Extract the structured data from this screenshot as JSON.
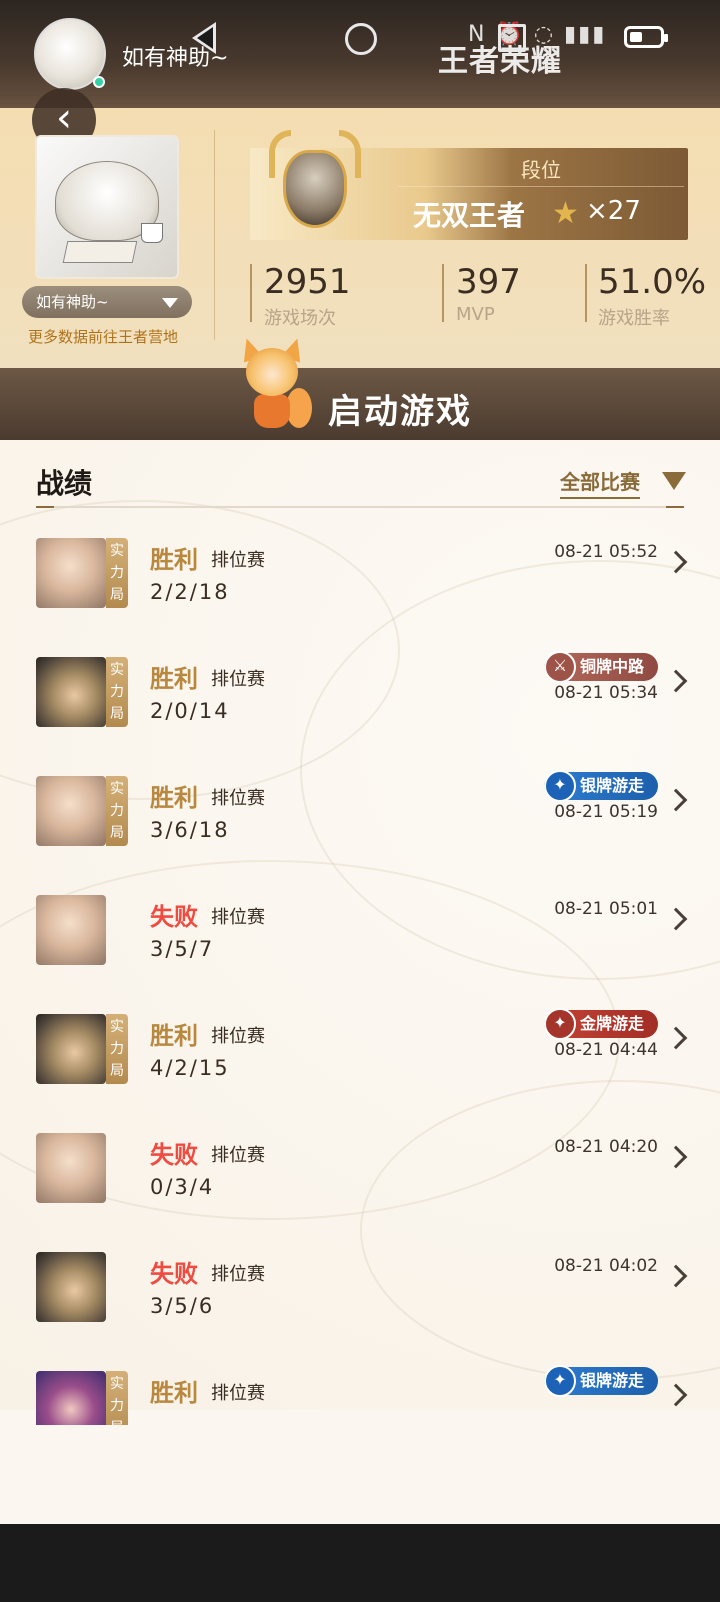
{
  "header": {
    "username": "如有神助~",
    "watermark": "王者荣耀",
    "status_icons": "N ⏰ ◌ ▮▮▮"
  },
  "profile": {
    "account_name": "如有神助~",
    "more_data_link": "更多数据前往王者营地",
    "rank_label": "段位",
    "rank_name": "无双王者",
    "star_count": "×27",
    "stats": [
      {
        "value": "2951",
        "label": "游戏场次"
      },
      {
        "value": "397",
        "label": "MVP"
      },
      {
        "value": "51.0%",
        "label": "游戏胜率"
      }
    ]
  },
  "launch": {
    "label": "启动游戏"
  },
  "records": {
    "title": "战绩",
    "filter_label": "全部比赛",
    "strong_tag": "实力局",
    "items": [
      {
        "result": "胜利",
        "mode": "排位赛",
        "kda": "2/2/18",
        "time": "08-21 05:52",
        "badge": ""
      },
      {
        "result": "胜利",
        "mode": "排位赛",
        "kda": "2/0/14",
        "time": "08-21 05:34",
        "badge": "铜牌中路"
      },
      {
        "result": "胜利",
        "mode": "排位赛",
        "kda": "3/6/18",
        "time": "08-21 05:19",
        "badge": "银牌游走"
      },
      {
        "result": "失败",
        "mode": "排位赛",
        "kda": "3/5/7",
        "time": "08-21 05:01",
        "badge": ""
      },
      {
        "result": "胜利",
        "mode": "排位赛",
        "kda": "4/2/15",
        "time": "08-21 04:44",
        "badge": "金牌游走"
      },
      {
        "result": "失败",
        "mode": "排位赛",
        "kda": "0/3/4",
        "time": "08-21 04:20",
        "badge": ""
      },
      {
        "result": "失败",
        "mode": "排位赛",
        "kda": "3/5/6",
        "time": "08-21 04:02",
        "badge": ""
      },
      {
        "result": "胜利",
        "mode": "排位赛",
        "kda": "",
        "time": "",
        "badge": "银牌游走"
      }
    ]
  },
  "colors": {
    "win": "#b8883f",
    "lose": "#ef4b41",
    "bronze_badge": "#b56a5a",
    "silver_badge": "#2e7ed2",
    "gold_badge": "#c44234",
    "accent": "#8a6b3a"
  },
  "nav": {
    "back_icon": "triangle-back-icon",
    "home_icon": "circle-home-icon",
    "recent_icon": "square-recent-icon"
  }
}
